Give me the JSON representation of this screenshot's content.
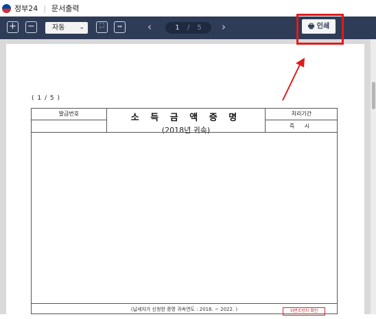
{
  "titlebar": {
    "brand": "정부24",
    "separator": "|",
    "title": "문서출력"
  },
  "toolbar": {
    "zoom_in_icon": "plus-box",
    "zoom_out_icon": "minus-box",
    "zoom_value": "자동",
    "fit_page_icon": "fit-page",
    "fit_width_icon": "fit-width",
    "page_current": "1",
    "page_separator": "/",
    "page_total": "5",
    "print_label": "인쇄"
  },
  "document": {
    "page_indicator": "( 1 / 5 )",
    "issue_no_label": "발급번호",
    "title": "소 득 금 액 증 명",
    "subtitle": "(2018년 귀속)",
    "processing_label": "처리기간",
    "processing_value": "즉 시",
    "footnote": "(납세자가 신청한 증명 귀속연도 : 2016. ~ 2022. )",
    "stamp_text": "위변조방지 확인"
  },
  "colors": {
    "toolbar_bg": "#2e3c57",
    "highlight": "#e01b1b",
    "viewer_bg": "#d9d9d9"
  }
}
